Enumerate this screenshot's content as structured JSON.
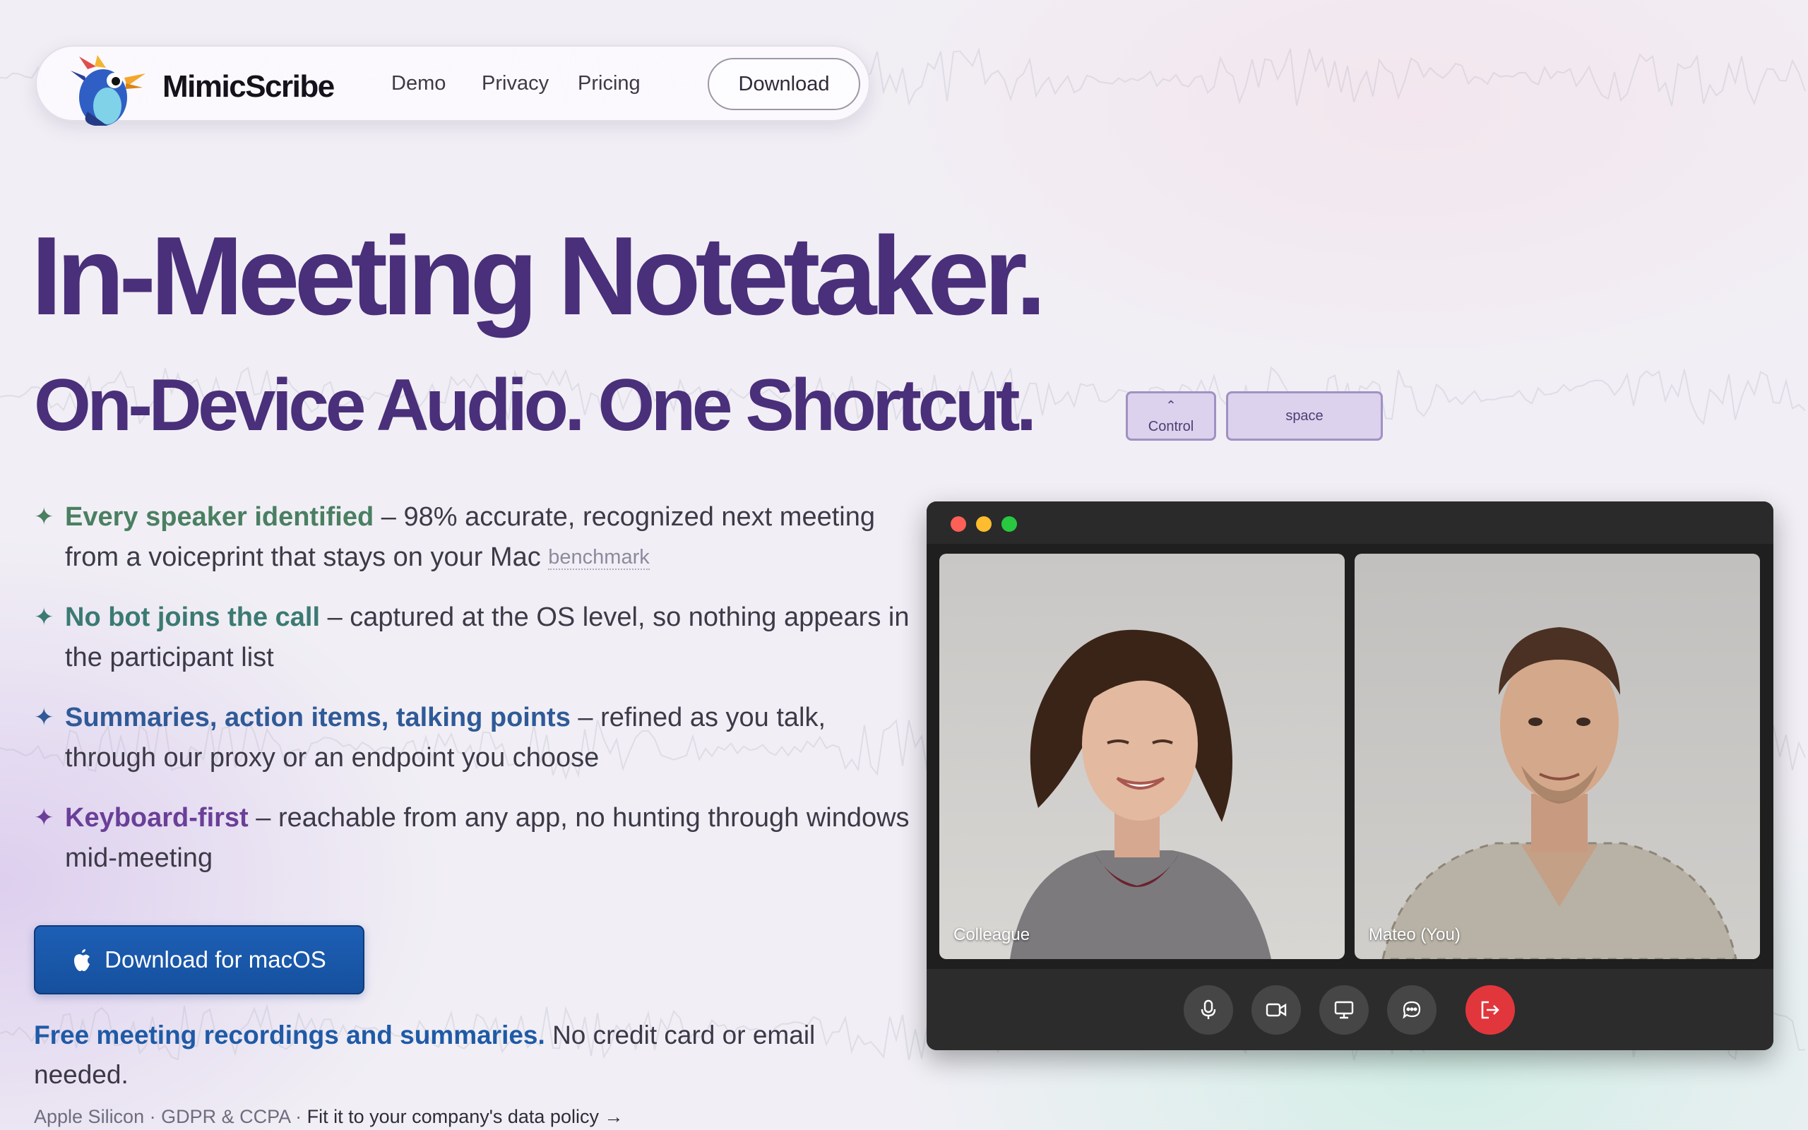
{
  "nav": {
    "brand": "MimicScribe",
    "links": [
      "Demo",
      "Privacy",
      "Pricing"
    ],
    "download_label": "Download"
  },
  "hero": {
    "title": "In-Meeting Notetaker.",
    "subtitle": "On-Device Audio. One Shortcut.",
    "keys": {
      "control_symbol": "⌃",
      "control": "Control",
      "space": "space"
    }
  },
  "features": [
    {
      "highlight": "Every speaker identified",
      "text": " – 98% accurate, recognized next meeting from a voiceprint that stays on your Mac ",
      "note": "benchmark",
      "color": "#4a7f62"
    },
    {
      "highlight": "No bot joins the call",
      "text": " – captured at the OS level, so nothing appears in the participant list",
      "note": "",
      "color": "#3b7a72"
    },
    {
      "highlight": "Summaries, action items, talking points",
      "text": " – refined as you talk, through our proxy or an endpoint you choose",
      "note": "",
      "color": "#2f5a97"
    },
    {
      "highlight": "Keyboard-first",
      "text": " – reachable from any app, no hunting through windows mid-meeting",
      "note": "",
      "color": "#6a3f98"
    }
  ],
  "cta": {
    "label": "Download for macOS",
    "icon": "apple-icon"
  },
  "tagline": {
    "highlight": "Free meeting recordings and summaries.",
    "rest": " No credit card or email needed."
  },
  "footnote": {
    "text": "Apple Silicon · GDPR & CCPA · ",
    "link": "Fit it to your company's data policy →"
  },
  "video_call": {
    "participants": [
      {
        "label": "Colleague"
      },
      {
        "label": "Mateo (You)"
      }
    ],
    "controls": [
      "microphone-icon",
      "camera-icon",
      "screen-share-icon",
      "chat-icon",
      "leave-call-icon"
    ]
  },
  "colors": {
    "heading": "#4a2f7a",
    "cta_blue": "#1d5fb5",
    "leave_red": "#e2363d",
    "traffic_red": "#fe5f57",
    "traffic_yellow": "#febc2e",
    "traffic_green": "#28c840"
  }
}
